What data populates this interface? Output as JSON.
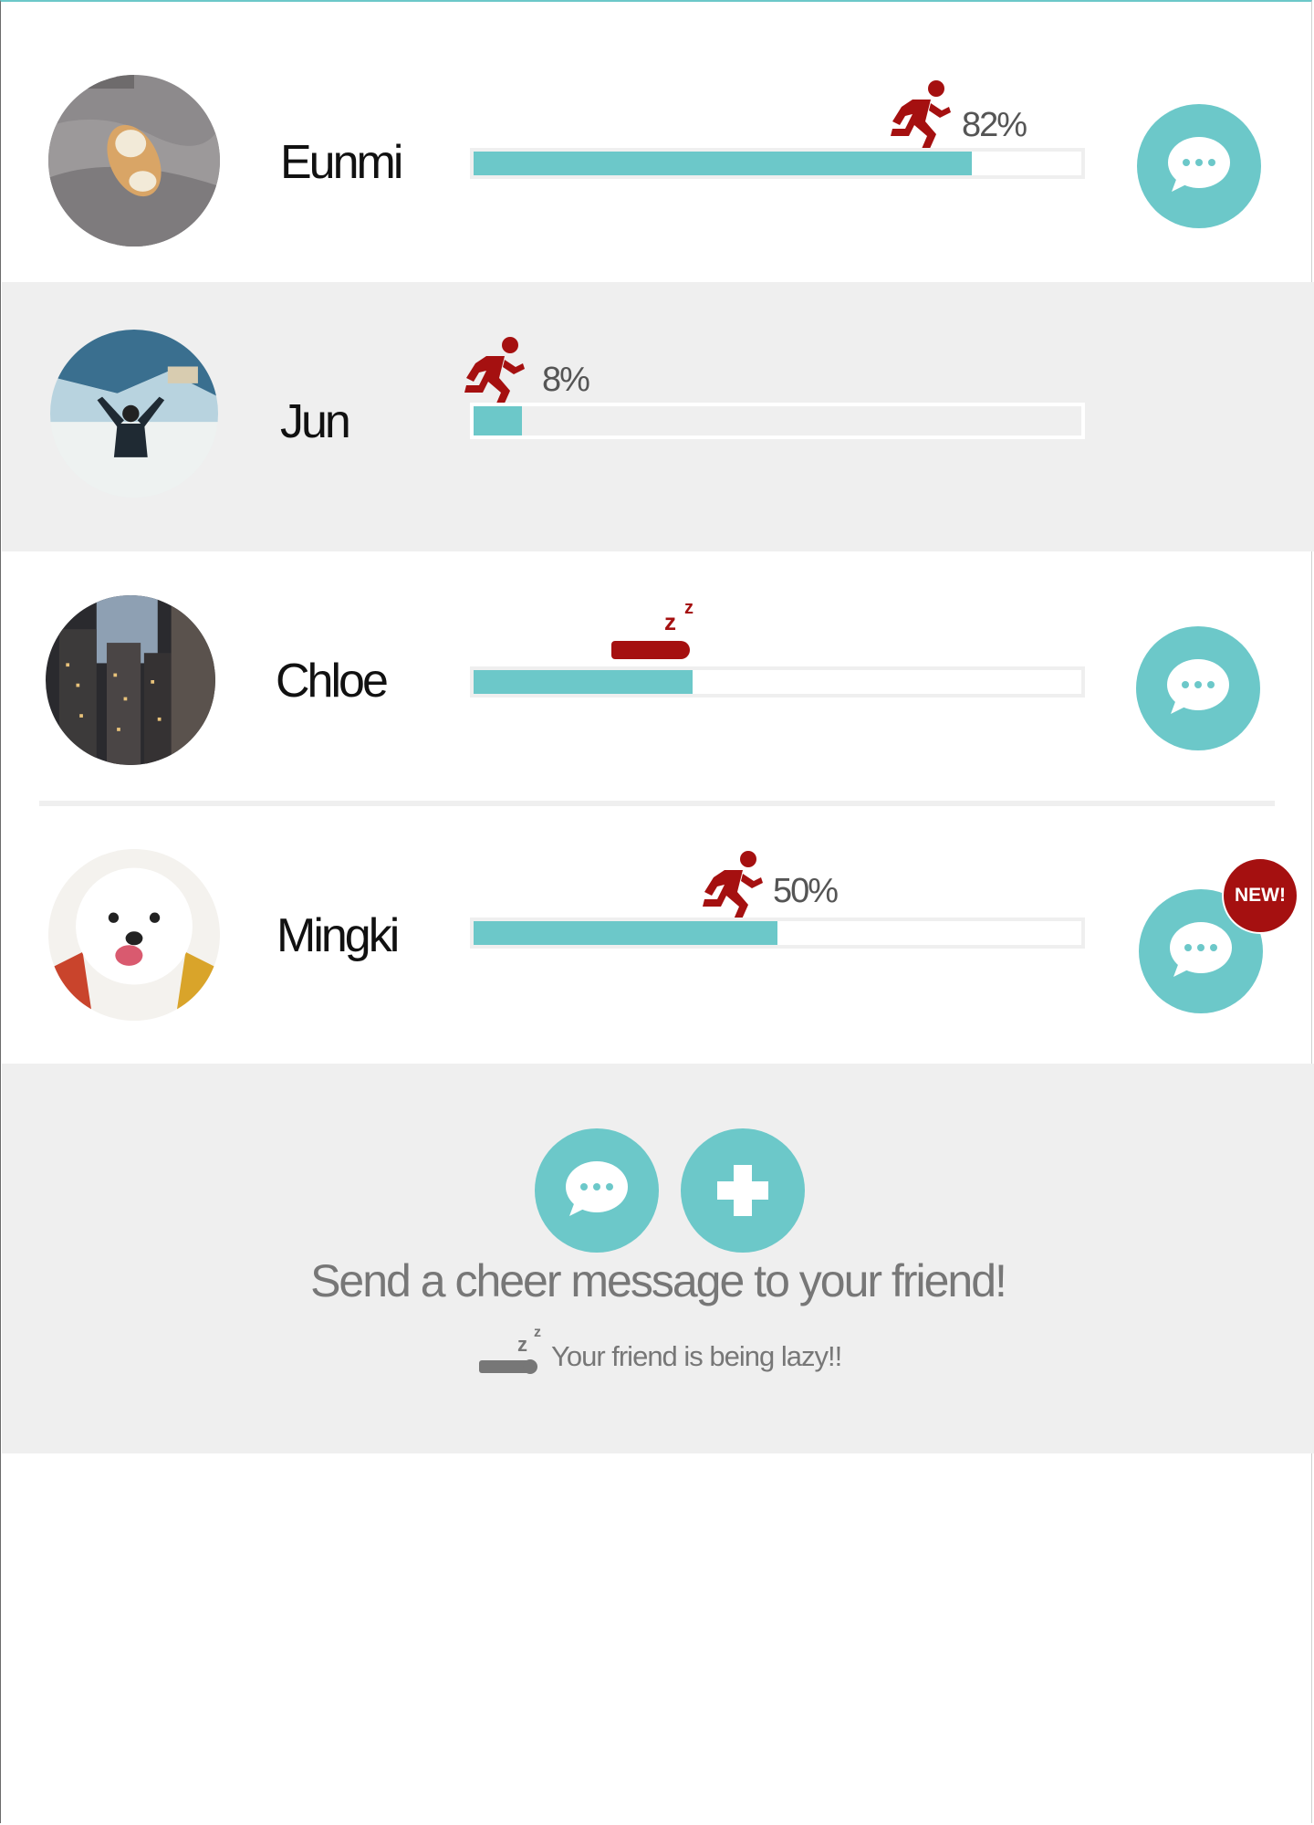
{
  "friends": [
    {
      "name": "Eunmi",
      "progress": 0.82,
      "progress_label": "82%",
      "status_icon": "running-icon",
      "has_chat": true,
      "new": false
    },
    {
      "name": "Jun",
      "progress": 0.08,
      "progress_label": "8%",
      "status_icon": "running-icon",
      "has_chat": false,
      "new": false
    },
    {
      "name": "Chloe",
      "progress": 0.36,
      "progress_label": "",
      "status_icon": "sleeping-icon",
      "has_chat": true,
      "new": false
    },
    {
      "name": "Mingki",
      "progress": 0.5,
      "progress_label": "50%",
      "status_icon": "running-icon",
      "has_chat": true,
      "new": true
    }
  ],
  "badge": {
    "new_label": "NEW!"
  },
  "footer": {
    "cheer_text": "Send a cheer message to your friend!",
    "legend_text": "Your friend is being lazy!!"
  },
  "colors": {
    "accent": "#6cc8c9",
    "runner": "#a51010",
    "stripe": "#efefef"
  }
}
